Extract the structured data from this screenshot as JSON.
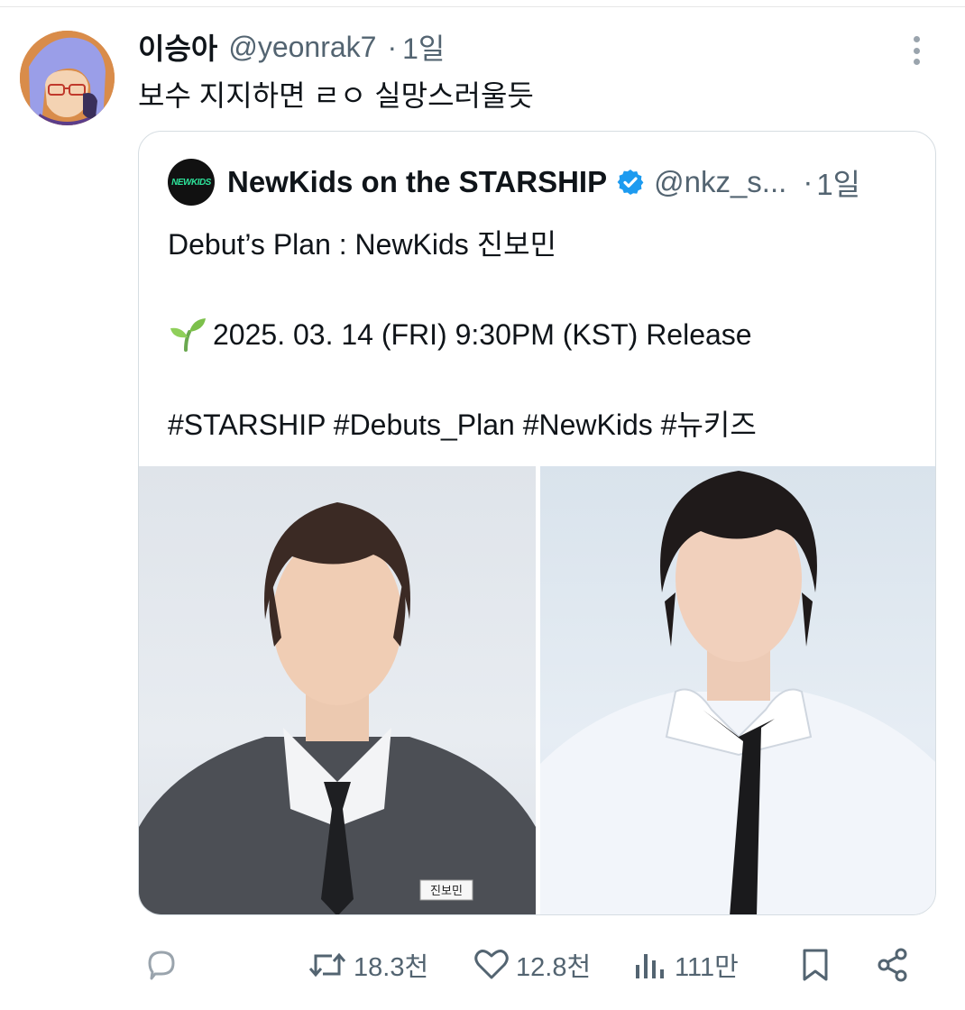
{
  "tweet": {
    "author_name": "이승아",
    "author_handle": "@yeonrak7",
    "separator": "·",
    "time": "1일",
    "text": "보수 지지하면 ㄹㅇ 실망스러울듯"
  },
  "quoted_tweet": {
    "avatar_text": "NEWKIDS",
    "author_name": "NewKids on the STARSHIP",
    "author_handle": "@nkz_s...",
    "separator": "·",
    "time": "1일",
    "lines": [
      "Debut’s Plan : NewKids 진보민",
      "",
      "2025. 03. 14 (FRI) 9:30PM (KST) Release",
      "",
      "#STARSHIP #Debuts_Plan #NewKids #뉴키즈"
    ],
    "photo_caption_badge": "진보민"
  },
  "actions": {
    "retweets": "18.3천",
    "likes": "12.8천",
    "views": "111만"
  },
  "colors": {
    "text": "#0f1419",
    "secondary": "#536471",
    "verified": "#1d9bf0",
    "border": "#d6dde2"
  }
}
